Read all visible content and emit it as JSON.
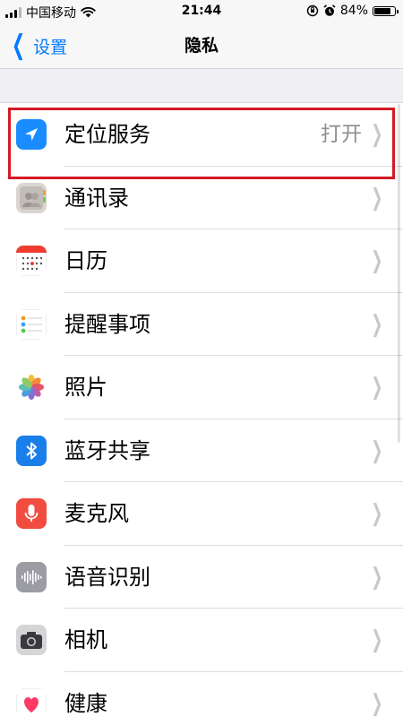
{
  "status_bar": {
    "carrier": "中国移动",
    "time": "21:44",
    "battery": "84%",
    "battery_level": 0.84
  },
  "nav": {
    "back_label": "设置",
    "title": "隐私"
  },
  "rows": [
    {
      "label": "定位服务",
      "value": "打开",
      "icon": "location-arrow-icon",
      "color": "#1a8cff"
    },
    {
      "label": "通讯录",
      "value": "",
      "icon": "contacts-icon",
      "color": "#b8b2ae"
    },
    {
      "label": "日历",
      "value": "",
      "icon": "calendar-icon",
      "color": "#ffffff"
    },
    {
      "label": "提醒事项",
      "value": "",
      "icon": "reminders-icon",
      "color": "#ffffff"
    },
    {
      "label": "照片",
      "value": "",
      "icon": "photos-icon",
      "color": "#ffffff"
    },
    {
      "label": "蓝牙共享",
      "value": "",
      "icon": "bluetooth-icon",
      "color": "#1a7fea"
    },
    {
      "label": "麦克风",
      "value": "",
      "icon": "microphone-icon",
      "color": "#f24b3f"
    },
    {
      "label": "语音识别",
      "value": "",
      "icon": "speech-recognition-icon",
      "color": "#9c9ca4"
    },
    {
      "label": "相机",
      "value": "",
      "icon": "camera-icon",
      "color": "#8e8e93"
    },
    {
      "label": "健康",
      "value": "",
      "icon": "health-icon",
      "color": "#ffffff"
    }
  ],
  "colors": {
    "highlight": "#d31a22",
    "link": "#007aff"
  }
}
